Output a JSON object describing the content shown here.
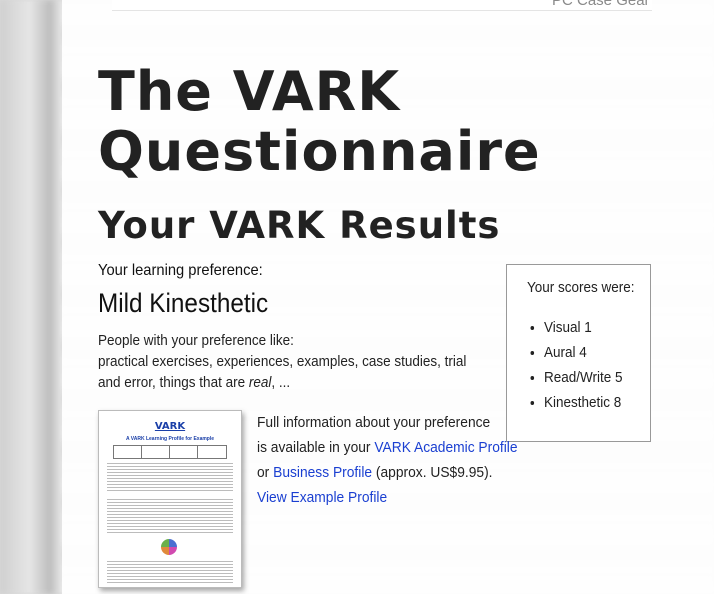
{
  "header": {
    "top_text": "PC Case Gear"
  },
  "page": {
    "title": "The VARK Questionnaire",
    "subtitle": "Your VARK Results"
  },
  "preference": {
    "label": "Your learning preference:",
    "value": "Mild Kinesthetic",
    "desc_intro": "People with your preference like:",
    "desc_body": "practical exercises, experiences, examples, case studies, trial and error, things that are ",
    "desc_italic": "real",
    "desc_end": ", ..."
  },
  "scores": {
    "title": "Your scores were:",
    "items": [
      {
        "label": "Visual 1"
      },
      {
        "label": "Aural 4"
      },
      {
        "label": "Read/Write 5"
      },
      {
        "label": "Kinesthetic 8"
      }
    ]
  },
  "thumbnail": {
    "logo": "VARK",
    "title": "A VARK Learning Profile for Example"
  },
  "info": {
    "line1": "Full information about your preference",
    "line2": "is available in your ",
    "academic_link": "VARK Academic Profile",
    "or_text": " or ",
    "business_link": "Business Profile",
    "price": " (approx. US$9.95).",
    "example_link": "View Example Profile"
  },
  "colors": {
    "link": "#1a3fd1",
    "text": "#222222"
  }
}
